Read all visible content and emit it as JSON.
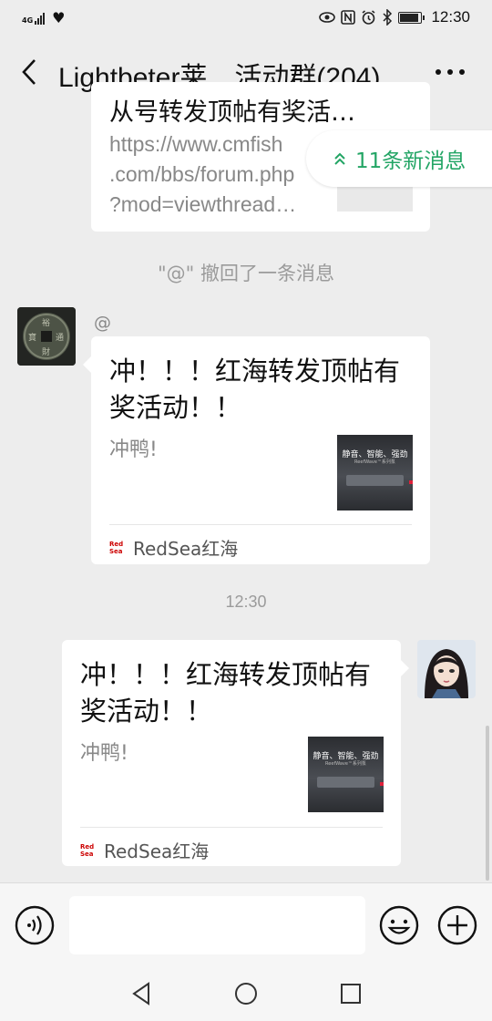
{
  "status_bar": {
    "network": "4G",
    "time": "12:30",
    "battery_level": 0.8,
    "icons": [
      "signal-icon",
      "heart-icon",
      "eye-icon",
      "nfc-icon",
      "alarm-icon",
      "bluetooth-icon",
      "battery-icon"
    ]
  },
  "header": {
    "back_icon": "chevron-left-icon",
    "title": "Lightbeter莱…活动群(204)",
    "more_icon": "more-dots-icon"
  },
  "new_messages_pill": {
    "label": "11条新消息",
    "icon": "double-chevron-up-icon",
    "color": "#23a565"
  },
  "messages": [
    {
      "type": "link-card",
      "side": "left",
      "title": "从号转发顶帖有奖活…",
      "desc": "https://www.cmfish.com/bbs/forum.php?mod=viewthread…",
      "desc_lines": [
        "https://www.cmfish",
        ".com/bbs/forum.php",
        "?mod=viewthread…"
      ]
    },
    {
      "type": "system",
      "text": "\"@\" 撤回了一条消息"
    },
    {
      "type": "link-card",
      "side": "left",
      "sender": "@",
      "title_lines": [
        "冲！！！红海转发顶帖有",
        "奖活动！！"
      ],
      "desc": "冲鸭!",
      "thumb_text": "静音、智能、强劲",
      "thumb_subtext": "ReefWave™系列泵",
      "source": "RedSea红海",
      "source_logo": "Red Sea"
    },
    {
      "type": "time",
      "text": "12:30"
    },
    {
      "type": "link-card",
      "side": "right",
      "title_lines": [
        "冲！！！红海转发顶帖有",
        "奖活动！！"
      ],
      "desc": "冲鸭!",
      "thumb_text": "静音、智能、强劲",
      "thumb_subtext": "ReefWave™系列泵",
      "source": "RedSea红海",
      "source_logo": "Red Sea"
    }
  ],
  "input_bar": {
    "voice_icon": "voice-icon",
    "value": "",
    "emoji_icon": "emoji-icon",
    "plus_icon": "plus-icon"
  },
  "nav_bar": {
    "icons": [
      "back-triangle-icon",
      "home-circle-icon",
      "recents-square-icon"
    ]
  }
}
